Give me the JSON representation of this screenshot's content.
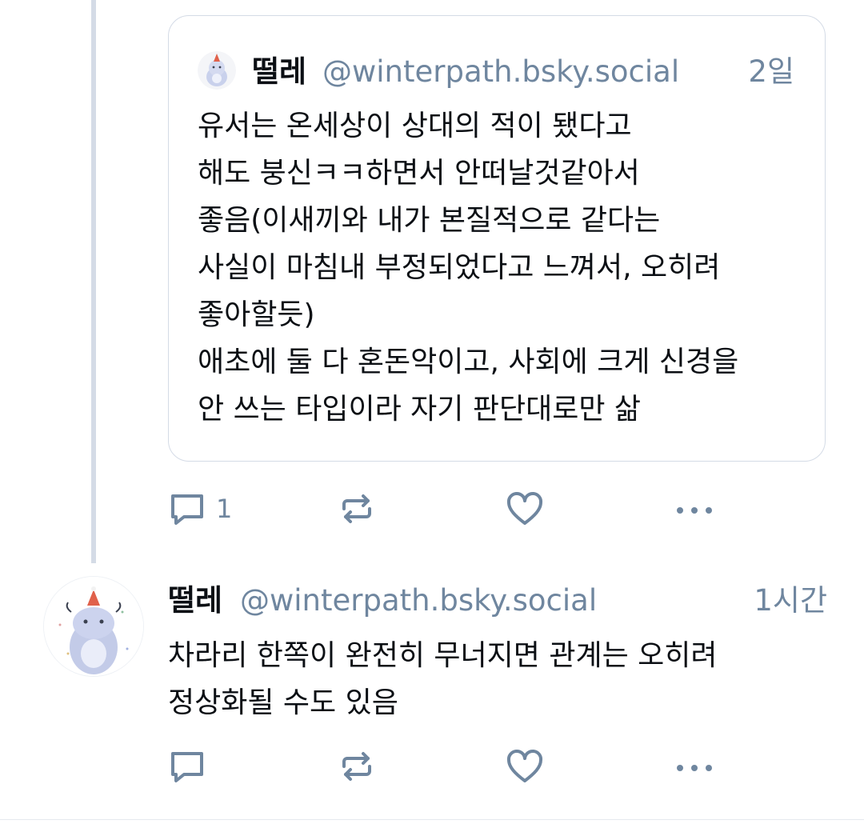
{
  "quoted_post": {
    "author_name": "떨레",
    "author_handle": "@winterpath.bsky.social",
    "time": "2일",
    "lines": [
      "유서는 온세상이 상대의 적이 됐다고",
      "해도 붕신ㅋㅋ하면서 안떠날것같아서",
      "좋음(이새끼와 내가 본질적으로 같다는",
      "사실이 마침내 부정되었다고 느껴서, 오히려",
      "좋아할듯)",
      "애초에 둘 다 혼돈악이고, 사회에 크게 신경을",
      "안 쓰는 타입이라 자기 판단대로만 삶"
    ]
  },
  "parent_actions": {
    "reply_count": "1"
  },
  "reply_post": {
    "author_name": "떨레",
    "author_handle": "@winterpath.bsky.social",
    "time": "1시간",
    "lines": [
      "차라리 한쪽이 완전히 무너지면 관계는 오히려",
      "정상화될 수도 있음"
    ]
  },
  "colors": {
    "muted": "#6f869f",
    "thread_line": "#d4dbe6",
    "border": "#d4dbe6"
  },
  "icons": [
    "reply-icon",
    "repost-icon",
    "like-icon",
    "more-icon"
  ]
}
